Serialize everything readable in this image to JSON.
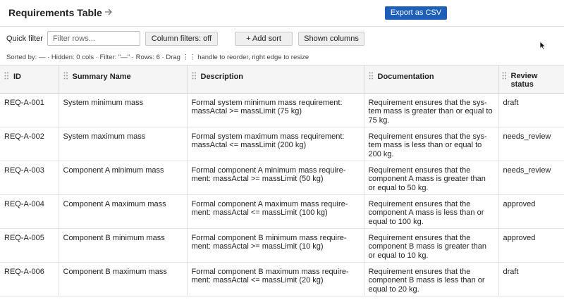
{
  "header": {
    "title": "Requirements Table",
    "export_label": "Export as CSV"
  },
  "toolbar": {
    "quick_filter_label": "Quick filter",
    "quick_filter_placeholder": "Filter rows...",
    "quick_filter_value": "",
    "column_filters_label": "Column filters: off",
    "add_sort_label": "+ Add sort",
    "shown_columns_label": "Shown columns"
  },
  "status": {
    "text": "Sorted by: — · Hidden: 0 cols · Filter: \"—\" · Rows: 6 · Drag ⋮⋮ handle to reorder, right edge to resize"
  },
  "table": {
    "columns": [
      "ID",
      "Summary Name",
      "Description",
      "Documentation",
      "Review status"
    ],
    "rows": [
      {
        "id": "REQ-A-001",
        "summary": "System minimum mass",
        "description": "Formal system minimum mass requirement: massActal >= massLimit (75 kg)",
        "documentation": "Requirement ensures that the sys­tem mass is greater than or equal to 75 kg.",
        "status": "draft"
      },
      {
        "id": "REQ-A-002",
        "summary": "System maximum mass",
        "description": "Formal system maximum mass requirement: massActal <= massLimit (200 kg)",
        "documentation": "Requirement ensures that the sys­tem mass is less than or equal to 200 kg.",
        "status": "needs_review"
      },
      {
        "id": "REQ-A-003",
        "summary": "Component A minimum mass",
        "description": "Formal component A minimum mass require­ment: massActal >= massLimit (50 kg)",
        "documentation": "Requirement ensures that the component A mass is greater than or equal to 50 kg.",
        "status": "needs_review"
      },
      {
        "id": "REQ-A-004",
        "summary": "Component A maximum mass",
        "description": "Formal component A maximum mass require­ment: massActal <= massLimit (100 kg)",
        "documentation": "Requirement ensures that the component A mass is less than or equal to 100 kg.",
        "status": "approved"
      },
      {
        "id": "REQ-A-005",
        "summary": "Component B minimum mass",
        "description": "Formal component B minimum mass require­ment: massActal >= massLimit (10 kg)",
        "documentation": "Requirement ensures that the component B mass is greater than or equal to 10 kg.",
        "status": "approved"
      },
      {
        "id": "REQ-A-006",
        "summary": "Component B maximum mass",
        "description": "Formal component B maximum mass require­ment: massActal <= massLimit (20 kg)",
        "documentation": "Requirement ensures that the component B mass is less than or equal to 20 kg.",
        "status": "draft"
      }
    ]
  },
  "icons": {
    "title_arrow": "arrow-right-icon",
    "drag_handle": "drag-handle-icon",
    "cursor": "mouse-pointer-icon"
  }
}
